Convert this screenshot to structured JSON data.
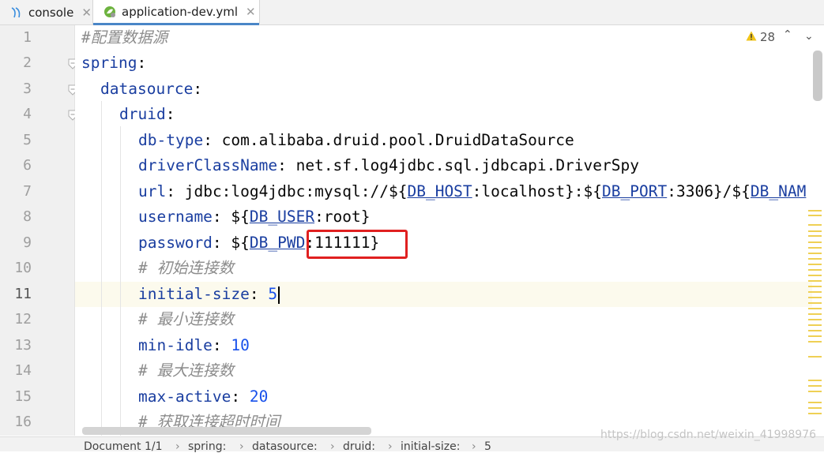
{
  "tabs": [
    {
      "label": "console",
      "icon": "database-console-icon"
    },
    {
      "label": "application-dev.yml",
      "icon": "spring-leaf-icon",
      "active": true
    }
  ],
  "inspections": {
    "count": "28",
    "icon": "warning-icon"
  },
  "line_numbers": [
    "1",
    "2",
    "3",
    "4",
    "5",
    "6",
    "7",
    "8",
    "9",
    "10",
    "11",
    "12",
    "13",
    "14",
    "15",
    "16"
  ],
  "code": {
    "l1": "#配置数据源",
    "l2_key": "spring",
    "l3_key": "datasource",
    "l4_key": "druid",
    "l5_key": "db-type",
    "l5_val": "com.alibaba.druid.pool.DruidDataSource",
    "l6_key": "driverClassName",
    "l6_val": "net.sf.log4jdbc.sql.jdbcapi.DriverSpy",
    "l7_key": "url",
    "l7_a": "jdbc:log4jdbc:mysql://${",
    "l7_v1": "DB_HOST",
    "l7_b": ":localhost}:${",
    "l7_v2": "DB_PORT",
    "l7_c": ":3306}/${",
    "l7_v3": "DB_NAM",
    "l8_key": "username",
    "l8_a": "${",
    "l8_var": "DB_USER",
    "l8_b": ":root}",
    "l9_key": "password",
    "l9_a": "${",
    "l9_var": "DB_PWD",
    "l9_b": ":111111}",
    "l10": "# 初始连接数",
    "l11_key": "initial-size",
    "l11_val": "5",
    "l12": "# 最小连接数",
    "l13_key": "min-idle",
    "l13_val": "10",
    "l14": "# 最大连接数",
    "l15_key": "max-active",
    "l15_val": "20",
    "l16": "# 获取连接超时时间"
  },
  "breadcrumbs": [
    "Document 1/1",
    "spring:",
    "datasource:",
    "druid:",
    "initial-size:",
    "5"
  ],
  "watermark": "https://blog.csdn.net/weixin_41998976",
  "colors": {
    "key": "#1a3ea0",
    "number": "#1750eb",
    "comment": "#8c8c8c",
    "caret_line": "#fcfaed",
    "highlight_box": "#e02020"
  }
}
